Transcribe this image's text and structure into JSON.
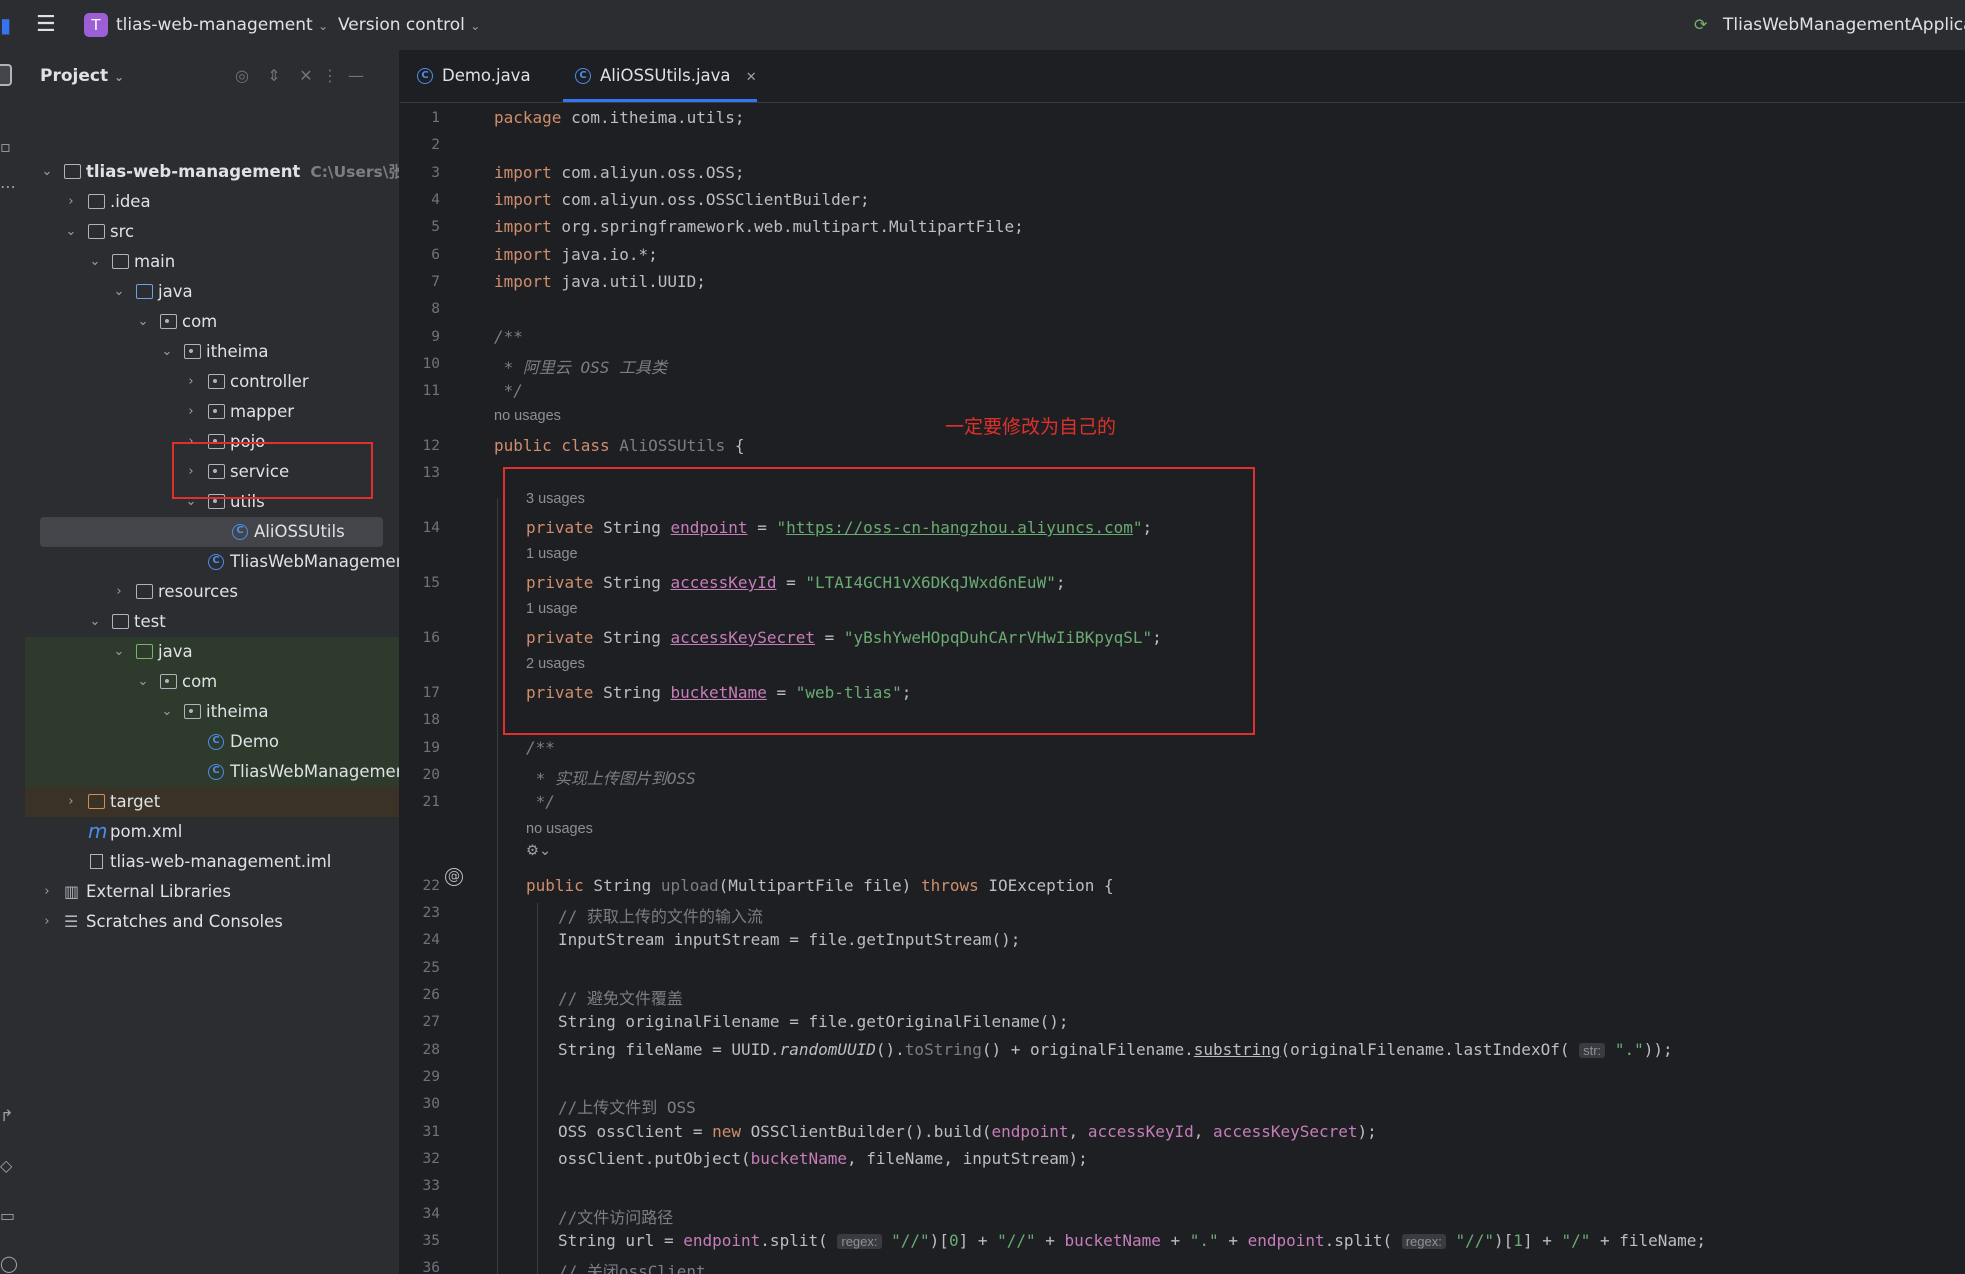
{
  "topbar": {
    "project_badge": "T",
    "project_name": "tlias-web-management",
    "vcs": "Version control",
    "run_config": "TliasWebManagementApplicatic"
  },
  "project_panel": {
    "title": "Project",
    "tree": [
      {
        "label": "tlias-web-management",
        "hint": "C:\\Users\\张喆",
        "depth": 0,
        "expanded": true,
        "type": "module",
        "bold": true
      },
      {
        "label": ".idea",
        "depth": 1,
        "expanded": false,
        "type": "folder"
      },
      {
        "label": "src",
        "depth": 1,
        "expanded": true,
        "type": "folder"
      },
      {
        "label": "main",
        "depth": 2,
        "expanded": true,
        "type": "folder"
      },
      {
        "label": "java",
        "depth": 3,
        "expanded": true,
        "type": "folder-blue"
      },
      {
        "label": "com",
        "depth": 4,
        "expanded": true,
        "type": "package"
      },
      {
        "label": "itheima",
        "depth": 5,
        "expanded": true,
        "type": "package"
      },
      {
        "label": "controller",
        "depth": 6,
        "expanded": false,
        "type": "package"
      },
      {
        "label": "mapper",
        "depth": 6,
        "expanded": false,
        "type": "package"
      },
      {
        "label": "pojo",
        "depth": 6,
        "expanded": false,
        "type": "package"
      },
      {
        "label": "service",
        "depth": 6,
        "expanded": false,
        "type": "package"
      },
      {
        "label": "utils",
        "depth": 6,
        "expanded": true,
        "type": "package"
      },
      {
        "label": "AliOSSUtils",
        "depth": 7,
        "type": "class",
        "selected": true
      },
      {
        "label": "TliasWebManagementApplication",
        "depth": 6,
        "type": "app-class"
      },
      {
        "label": "resources",
        "depth": 3,
        "expanded": false,
        "type": "resources"
      },
      {
        "label": "test",
        "depth": 2,
        "expanded": true,
        "type": "folder"
      },
      {
        "label": "java",
        "depth": 3,
        "expanded": true,
        "type": "folder-green",
        "test": true
      },
      {
        "label": "com",
        "depth": 4,
        "expanded": true,
        "type": "package",
        "test": true
      },
      {
        "label": "itheima",
        "depth": 5,
        "expanded": true,
        "type": "package",
        "test": true
      },
      {
        "label": "Demo",
        "depth": 6,
        "type": "class",
        "test": true
      },
      {
        "label": "TliasWebManagementApplicationTests",
        "depth": 6,
        "type": "class",
        "test": true
      },
      {
        "label": "target",
        "depth": 1,
        "expanded": false,
        "type": "folder-orange",
        "excluded": true
      },
      {
        "label": "pom.xml",
        "depth": 1,
        "type": "maven"
      },
      {
        "label": "tlias-web-management.iml",
        "depth": 1,
        "type": "file"
      },
      {
        "label": "External Libraries",
        "depth": 0,
        "expanded": false,
        "type": "library"
      },
      {
        "label": "Scratches and Consoles",
        "depth": 0,
        "expanded": false,
        "type": "scratch"
      }
    ]
  },
  "tabs": [
    {
      "label": "Demo.java",
      "active": false
    },
    {
      "label": "AliOSSUtils.java",
      "active": true
    }
  ],
  "annotation": "一定要修改为自己的",
  "code": {
    "package": "com.itheima.utils",
    "imports": [
      "com.aliyun.oss.OSS",
      "com.aliyun.oss.OSSClientBuilder",
      "org.springframework.web.multipart.MultipartFile",
      "java.io.*",
      "java.util.UUID"
    ],
    "doc1": "阿里云 OSS 工具类",
    "class_usages": "no usages",
    "class_name": "AliOSSUtils",
    "fields": [
      {
        "usages": "3 usages",
        "name": "endpoint",
        "value": "https://oss-cn-hangzhou.aliyuncs.com"
      },
      {
        "usages": "1 usage",
        "name": "accessKeyId",
        "value": "LTAI4GCH1vX6DKqJWxd6nEuW"
      },
      {
        "usages": "1 usage",
        "name": "accessKeySecret",
        "value": "yBshYweHOpqDuhCArrVHwIiBKpyqSL"
      },
      {
        "usages": "2 usages",
        "name": "bucketName",
        "value": "web-tlias"
      }
    ],
    "doc2": "实现上传图片到OSS",
    "method_usages": "no usages",
    "comment_input": "// 获取上传的文件的输入流",
    "comment_avoid": "// 避免文件覆盖",
    "comment_upload": "//上传文件到 OSS",
    "comment_path": "//文件访问路径",
    "comment_close": "// 关闭ossClient",
    "hint_str": "str:",
    "hint_regex": "regex:"
  }
}
